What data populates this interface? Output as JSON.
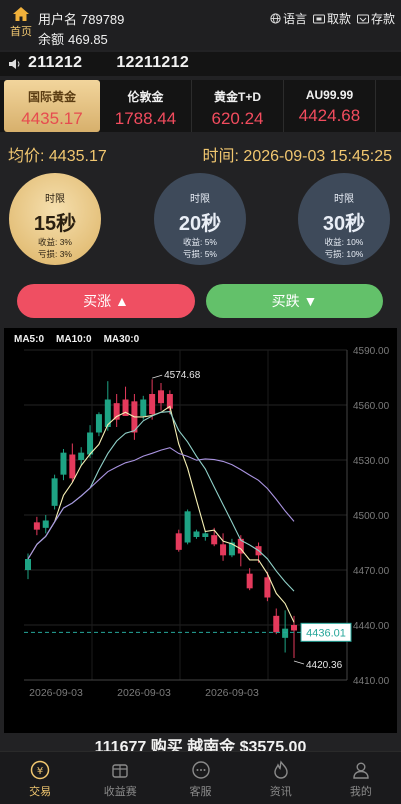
{
  "header": {
    "home_label": "首页",
    "username_label": "用户名",
    "username": "789789",
    "balance_label": "余额",
    "balance": "469.85",
    "links": [
      {
        "label": "语言",
        "icon": "globe-icon"
      },
      {
        "label": "取款",
        "icon": "withdraw-icon"
      },
      {
        "label": "存款",
        "icon": "deposit-icon"
      }
    ]
  },
  "ticker": {
    "icon": "speaker-icon",
    "items": [
      "211212",
      "12211212"
    ]
  },
  "quotes": [
    {
      "name": "国际黄金",
      "price": "4435.17",
      "selected": true
    },
    {
      "name": "伦敦金",
      "price": "1788.44",
      "selected": false
    },
    {
      "name": "黄金T+D",
      "price": "620.24",
      "selected": false
    },
    {
      "name": "AU99.99",
      "price": "4424.68",
      "selected": false
    }
  ],
  "info": {
    "avg_label": "均价:",
    "avg_value": "4435.17",
    "time_label": "时间:",
    "time_value": "2026-09-03 15:45:25"
  },
  "timers": [
    {
      "label": "时限",
      "seconds": "15秒",
      "profit": "收益: 3%",
      "loss": "亏损: 3%",
      "active": true
    },
    {
      "label": "时限",
      "seconds": "20秒",
      "profit": "收益: 5%",
      "loss": "亏损: 5%",
      "active": false
    },
    {
      "label": "时限",
      "seconds": "30秒",
      "profit": "收益: 10%",
      "loss": "亏损: 10%",
      "active": false
    }
  ],
  "buttons": {
    "buy_up": "买涨 ▲",
    "buy_down": "买跌 ▼"
  },
  "chart": {
    "ma_labels": [
      "MA5:0",
      "MA10:0",
      "MA30:0"
    ],
    "y_ticks": [
      "4590.00",
      "4560.00",
      "4530.00",
      "4500.00",
      "4470.00",
      "4440.00",
      "4410.00"
    ],
    "x_ticks": [
      "2026-09-03",
      "2026-09-03",
      "2026-09-03"
    ],
    "high_label": "4574.68",
    "low_label": "4420.36",
    "current_label": "4436.01",
    "colors": {
      "up": "#1ea384",
      "down": "#e43a5c",
      "ma5": "#f6f0b4",
      "ma10": "#8fd0c8",
      "ma30": "#a993e0",
      "current": "#26a69a"
    }
  },
  "chart_data": {
    "type": "candlestick",
    "title": "",
    "xlabel": "",
    "ylabel": "",
    "ylim": [
      4410,
      4590
    ],
    "high": 4574.68,
    "low": 4420.36,
    "current": 4436.01,
    "candles": [
      {
        "o": 4470,
        "c": 4476,
        "h": 4479,
        "l": 4465
      },
      {
        "o": 4496,
        "c": 4492,
        "h": 4499,
        "l": 4489
      },
      {
        "o": 4493,
        "c": 4497,
        "h": 4500,
        "l": 4490
      },
      {
        "o": 4505,
        "c": 4520,
        "h": 4522,
        "l": 4503
      },
      {
        "o": 4522,
        "c": 4534,
        "h": 4536,
        "l": 4519
      },
      {
        "o": 4533,
        "c": 4520,
        "h": 4539,
        "l": 4518
      },
      {
        "o": 4530,
        "c": 4534,
        "h": 4537,
        "l": 4527
      },
      {
        "o": 4533,
        "c": 4545,
        "h": 4549,
        "l": 4531
      },
      {
        "o": 4545,
        "c": 4555,
        "h": 4556,
        "l": 4543
      },
      {
        "o": 4548,
        "c": 4563,
        "h": 4573,
        "l": 4546
      },
      {
        "o": 4561,
        "c": 4552,
        "h": 4566,
        "l": 4548
      },
      {
        "o": 4563,
        "c": 4554,
        "h": 4570,
        "l": 4554
      },
      {
        "o": 4562,
        "c": 4545,
        "h": 4566,
        "l": 4541
      },
      {
        "o": 4554,
        "c": 4563,
        "h": 4565,
        "l": 4552
      },
      {
        "o": 4566,
        "c": 4555,
        "h": 4574,
        "l": 4552
      },
      {
        "o": 4568,
        "c": 4561,
        "h": 4572,
        "l": 4557
      },
      {
        "o": 4566,
        "c": 4558,
        "h": 4568,
        "l": 4555
      },
      {
        "o": 4490,
        "c": 4481,
        "h": 4492,
        "l": 4480
      },
      {
        "o": 4485,
        "c": 4502,
        "h": 4503,
        "l": 4484
      },
      {
        "o": 4488,
        "c": 4491,
        "h": 4492,
        "l": 4487
      },
      {
        "o": 4488,
        "c": 4490,
        "h": 4491,
        "l": 4486
      },
      {
        "o": 4489,
        "c": 4484,
        "h": 4493,
        "l": 4483
      },
      {
        "o": 4484,
        "c": 4478,
        "h": 4490,
        "l": 4475
      },
      {
        "o": 4478,
        "c": 4485,
        "h": 4487,
        "l": 4477
      },
      {
        "o": 4487,
        "c": 4479,
        "h": 4489,
        "l": 4472
      },
      {
        "o": 4468,
        "c": 4460,
        "h": 4471,
        "l": 4459
      },
      {
        "o": 4483,
        "c": 4478,
        "h": 4485,
        "l": 4474
      },
      {
        "o": 4466,
        "c": 4455,
        "h": 4469,
        "l": 4453
      },
      {
        "o": 4445,
        "c": 4436,
        "h": 4449,
        "l": 4435
      },
      {
        "o": 4433,
        "c": 4438,
        "h": 4448,
        "l": 4425
      },
      {
        "o": 4440,
        "c": 4437,
        "h": 4445,
        "l": 4422
      }
    ]
  },
  "message": "111677 购买 越南金 $3575.00",
  "nav": [
    {
      "label": "交易",
      "icon": "trade-icon",
      "active": true
    },
    {
      "label": "收益赛",
      "icon": "contest-icon",
      "active": false
    },
    {
      "label": "客服",
      "icon": "chat-icon",
      "active": false
    },
    {
      "label": "资讯",
      "icon": "fire-icon",
      "active": false
    },
    {
      "label": "我的",
      "icon": "user-icon",
      "active": false
    }
  ]
}
